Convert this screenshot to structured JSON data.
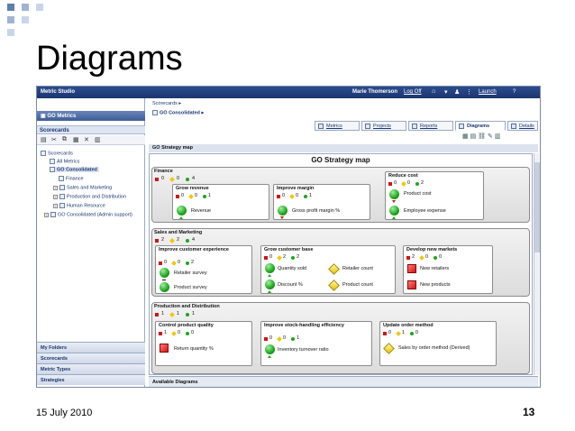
{
  "slide": {
    "title": "Diagrams",
    "date": "15 July 2010",
    "page": "13"
  },
  "app": {
    "name": "Metric Studio",
    "user": "Marie Thomerson",
    "logoff": "Log Off",
    "toolbar_right": [
      "Launch",
      "?"
    ]
  },
  "left_panel": {
    "header": "GO Metrics",
    "section": "Scorecards",
    "tree": [
      {
        "label": "Scorecards"
      },
      {
        "label": "All Metrics"
      },
      {
        "label": "GO Consolidated"
      },
      {
        "label": "Finance"
      },
      {
        "label": "Sales and Marketing"
      },
      {
        "label": "Production and Distribution"
      },
      {
        "label": "Human Resource"
      },
      {
        "label": "GO Consolidated (Admin support)"
      }
    ],
    "bottom_tabs": [
      "My Folders",
      "Scorecards",
      "Metric Types",
      "Strategies"
    ]
  },
  "main": {
    "breadcrumb": "Scorecards",
    "current": "GO Consolidated",
    "tabs": [
      "Metrics",
      "Projects",
      "Reports",
      "Diagrams",
      "Details"
    ],
    "active_tab": "Diagrams",
    "panel_title": "GO Strategy map",
    "map_title": "GO Strategy map",
    "footer": "Available Diagrams"
  },
  "strategy_map": {
    "finance": {
      "name": "Finance",
      "counts": [
        "0",
        "0",
        "4"
      ],
      "boxes": {
        "grow_revenue": {
          "title": "Grow revenue",
          "counts": [
            "0",
            "0",
            "1"
          ],
          "kpis": [
            "Revenue"
          ]
        },
        "improve_margin": {
          "title": "Improve margin",
          "counts": [
            "0",
            "0",
            "1"
          ],
          "kpis": [
            "Gross profit margin %"
          ]
        },
        "reduce_cost": {
          "title": "Reduce cost",
          "counts": [
            "0",
            "0",
            "2"
          ],
          "kpis": [
            "Product cost",
            "Employee expense"
          ]
        }
      }
    },
    "sales": {
      "name": "Sales and Marketing",
      "counts": [
        "2",
        "2",
        "4"
      ],
      "boxes": {
        "improve_cx": {
          "title": "Improve customer experience",
          "counts": [
            "0",
            "0",
            "2"
          ],
          "kpis": [
            "Retailer survey",
            "Product survey"
          ]
        },
        "grow_base": {
          "title": "Grow customer base",
          "counts": [
            "0",
            "2",
            "2"
          ],
          "kpis": [
            "Quantity sold",
            "Retailer count",
            "Discount %",
            "Product count"
          ]
        },
        "new_markets": {
          "title": "Develop new markets",
          "counts": [
            "2",
            "0",
            "0"
          ],
          "kpis": [
            "New retailers",
            "New products"
          ]
        }
      }
    },
    "production": {
      "name": "Production and Distribution",
      "counts": [
        "1",
        "1",
        "1"
      ],
      "boxes": {
        "quality": {
          "title": "Control product quality",
          "counts": [
            "1",
            "0",
            "0"
          ],
          "kpis": [
            "Return quantity %"
          ]
        },
        "stock": {
          "title": "Improve stock-handling efficiency",
          "counts": [
            "0",
            "0",
            "1"
          ],
          "kpis": [
            "Inventory turnover ratio"
          ]
        },
        "order": {
          "title": "Update order method",
          "counts": [
            "0",
            "1",
            "0"
          ],
          "kpis": [
            "Sales by order method (Derived)"
          ]
        }
      }
    }
  },
  "colors": {
    "accent": "#1b3570",
    "red": "#d41414",
    "yellow": "#f0c800",
    "green": "#1ea51e"
  }
}
